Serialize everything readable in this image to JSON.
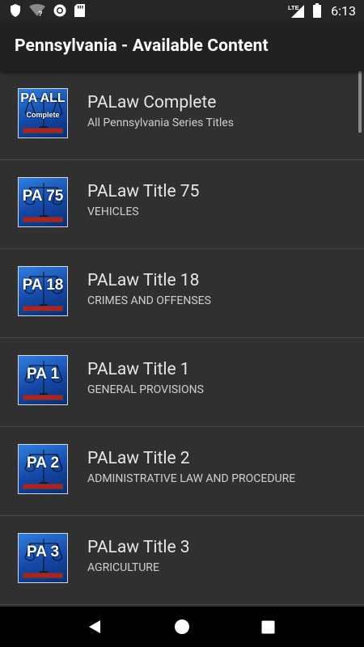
{
  "status_bar": {
    "time": "6:13",
    "network_label": "LTE",
    "icons": [
      "shield-icon",
      "wifi-unknown-icon",
      "circle-status-icon",
      "sd-card-icon",
      "cell-signal-icon",
      "battery-icon"
    ]
  },
  "app_bar": {
    "title": "Pennsylvania - Available Content"
  },
  "colors": {
    "background": "#303030",
    "app_bar": "#212121",
    "status_bar": "#262626",
    "thumbnail_blue": "#1448a8",
    "thumbnail_bar": "#b51f1f"
  },
  "items": [
    {
      "title": "PALaw Complete",
      "subtitle": "All Pennsylvania Series Titles",
      "thumb_code": "PA ALL",
      "thumb_sub": "Complete"
    },
    {
      "title": "PALaw Title 75",
      "subtitle": "VEHICLES",
      "thumb_code": "PA 75"
    },
    {
      "title": "PALaw Title 18",
      "subtitle": "CRIMES AND OFFENSES",
      "thumb_code": "PA 18"
    },
    {
      "title": "PALaw Title 1",
      "subtitle": "GENERAL PROVISIONS",
      "thumb_code": "PA 1"
    },
    {
      "title": "PALaw Title 2",
      "subtitle": "ADMINISTRATIVE LAW AND PROCEDURE",
      "thumb_code": "PA 2"
    },
    {
      "title": "PALaw Title 3",
      "subtitle": "AGRICULTURE",
      "thumb_code": "PA 3"
    }
  ],
  "nav_bar": {
    "buttons": [
      "back-icon",
      "home-icon",
      "recents-icon"
    ]
  }
}
